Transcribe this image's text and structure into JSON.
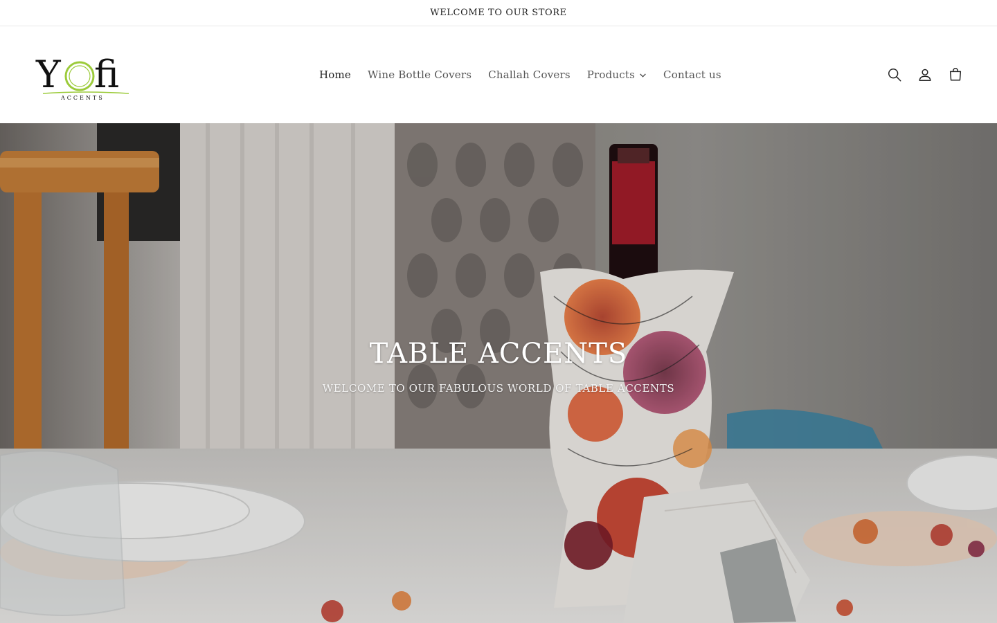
{
  "announcement": {
    "text": "WELCOME TO OUR STORE"
  },
  "brand": {
    "name_main": "Yofi",
    "name_sub": "ACCENTS",
    "accent_color": "#9ccb3b"
  },
  "nav": {
    "items": [
      {
        "label": "Home",
        "active": true
      },
      {
        "label": "Wine Bottle Covers"
      },
      {
        "label": "Challah Covers"
      },
      {
        "label": "Products",
        "has_dropdown": true
      },
      {
        "label": "Contact us"
      }
    ]
  },
  "header_icons": [
    "search-icon",
    "account-icon",
    "cart-icon"
  ],
  "hero": {
    "title": "TABLE ACCENTS",
    "subtitle": "WELCOME TO OUR FABULOUS WORLD OF TABLE ACCENTS"
  }
}
